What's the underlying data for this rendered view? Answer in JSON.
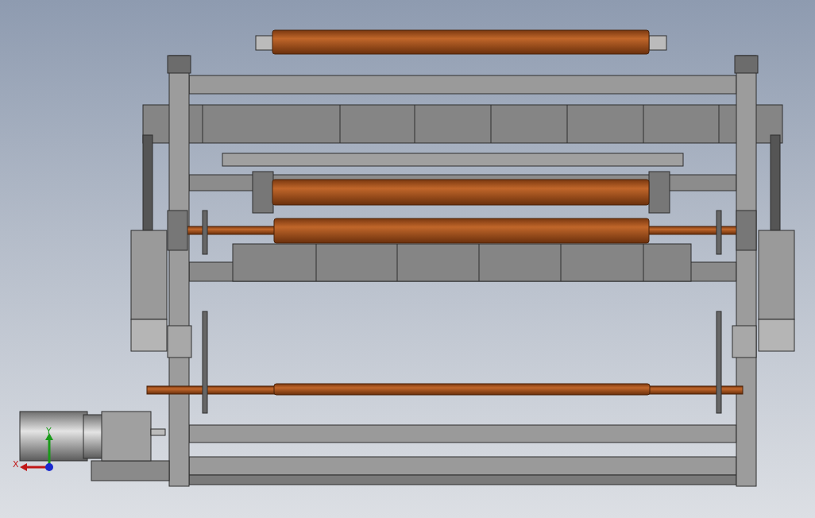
{
  "viewport": {
    "axes": [
      {
        "label": "X"
      },
      {
        "label": "Y"
      }
    ]
  }
}
